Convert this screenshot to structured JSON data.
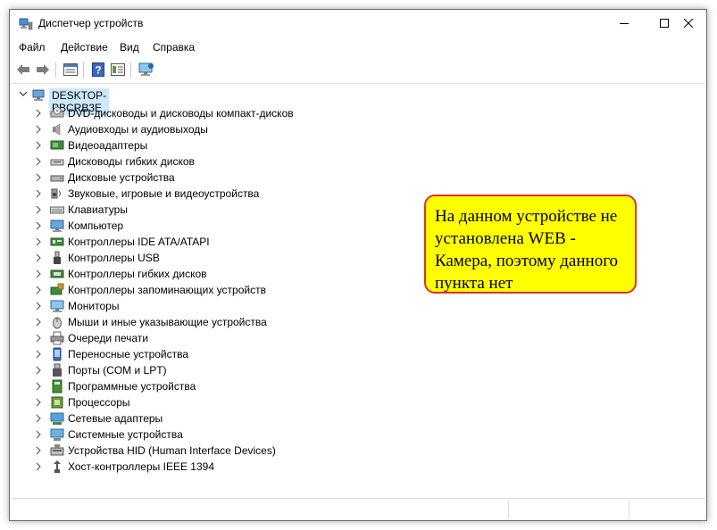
{
  "window": {
    "title": "Диспетчер устройств",
    "minimize": "—",
    "maximize": "☐",
    "close": "✕"
  },
  "menu": [
    "Файл",
    "Действие",
    "Вид",
    "Справка"
  ],
  "toolbar": {
    "icons": [
      "back-icon",
      "forward-icon",
      "properties-icon",
      "help-icon",
      "view-icon",
      "monitor-icon"
    ]
  },
  "tree": {
    "root": "DESKTOP-PBCRB3E",
    "nodes": [
      {
        "label": "DVD-дисководы и дисководы компакт-дисков",
        "icon": "dvd-drive-icon"
      },
      {
        "label": "Аудиовходы и аудиовыходы",
        "icon": "speaker-icon"
      },
      {
        "label": "Видеоадаптеры",
        "icon": "display-adapter-icon"
      },
      {
        "label": "Дисководы гибких дисков",
        "icon": "floppy-drive-icon"
      },
      {
        "label": "Дисковые устройства",
        "icon": "disk-drive-icon"
      },
      {
        "label": "Звуковые, игровые и видеоустройства",
        "icon": "sound-icon"
      },
      {
        "label": "Клавиатуры",
        "icon": "keyboard-icon"
      },
      {
        "label": "Компьютер",
        "icon": "computer-icon"
      },
      {
        "label": "Контроллеры IDE ATA/ATAPI",
        "icon": "ide-controller-icon"
      },
      {
        "label": "Контроллеры USB",
        "icon": "usb-icon"
      },
      {
        "label": "Контроллеры гибких дисков",
        "icon": "floppy-controller-icon"
      },
      {
        "label": "Контроллеры запоминающих устройств",
        "icon": "storage-controller-icon"
      },
      {
        "label": "Мониторы",
        "icon": "monitor-icon"
      },
      {
        "label": "Мыши и иные указывающие устройства",
        "icon": "mouse-icon"
      },
      {
        "label": "Очереди печати",
        "icon": "printer-icon"
      },
      {
        "label": "Переносные устройства",
        "icon": "portable-device-icon"
      },
      {
        "label": "Порты (COM и LPT)",
        "icon": "port-icon"
      },
      {
        "label": "Программные устройства",
        "icon": "software-device-icon"
      },
      {
        "label": "Процессоры",
        "icon": "processor-icon"
      },
      {
        "label": "Сетевые адаптеры",
        "icon": "network-adapter-icon"
      },
      {
        "label": "Системные устройства",
        "icon": "system-device-icon"
      },
      {
        "label": "Устройства HID (Human Interface Devices)",
        "icon": "hid-icon"
      },
      {
        "label": "Хост-контроллеры IEEE 1394",
        "icon": "ieee1394-icon"
      }
    ]
  },
  "callout": {
    "text": "На данном устройстве не установлена WEB - Камера, поэтому данного пункта нет"
  },
  "colors": {
    "selection": "#cce8ff",
    "callout_fill": "#ffff00",
    "callout_border": "#e23030"
  }
}
